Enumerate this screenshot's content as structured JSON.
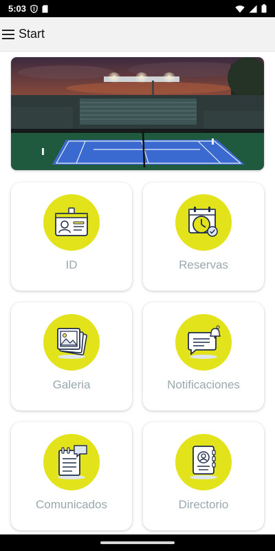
{
  "status_bar": {
    "time": "5:03",
    "icons": [
      "shield-icon",
      "sd-card-icon",
      "wifi-icon",
      "signal-icon",
      "battery-icon"
    ]
  },
  "app_bar": {
    "title": "Start",
    "menu_icon": "hamburger-menu-icon"
  },
  "banner": {
    "image": "tennis-court-night-photo"
  },
  "tiles": [
    {
      "label": "ID",
      "icon": "id-card-icon"
    },
    {
      "label": "Reservas",
      "icon": "calendar-clock-icon"
    },
    {
      "label": "Galeria",
      "icon": "photo-gallery-icon"
    },
    {
      "label": "Notificaciones",
      "icon": "notification-bell-icon"
    },
    {
      "label": "Comunicados",
      "icon": "notepad-message-icon"
    },
    {
      "label": "Directorio",
      "icon": "contact-book-icon"
    }
  ],
  "colors": {
    "accent_yellow": "#e3e31b",
    "label_gray": "#9aa9ad",
    "app_bar_bg": "#f2f2f2"
  }
}
